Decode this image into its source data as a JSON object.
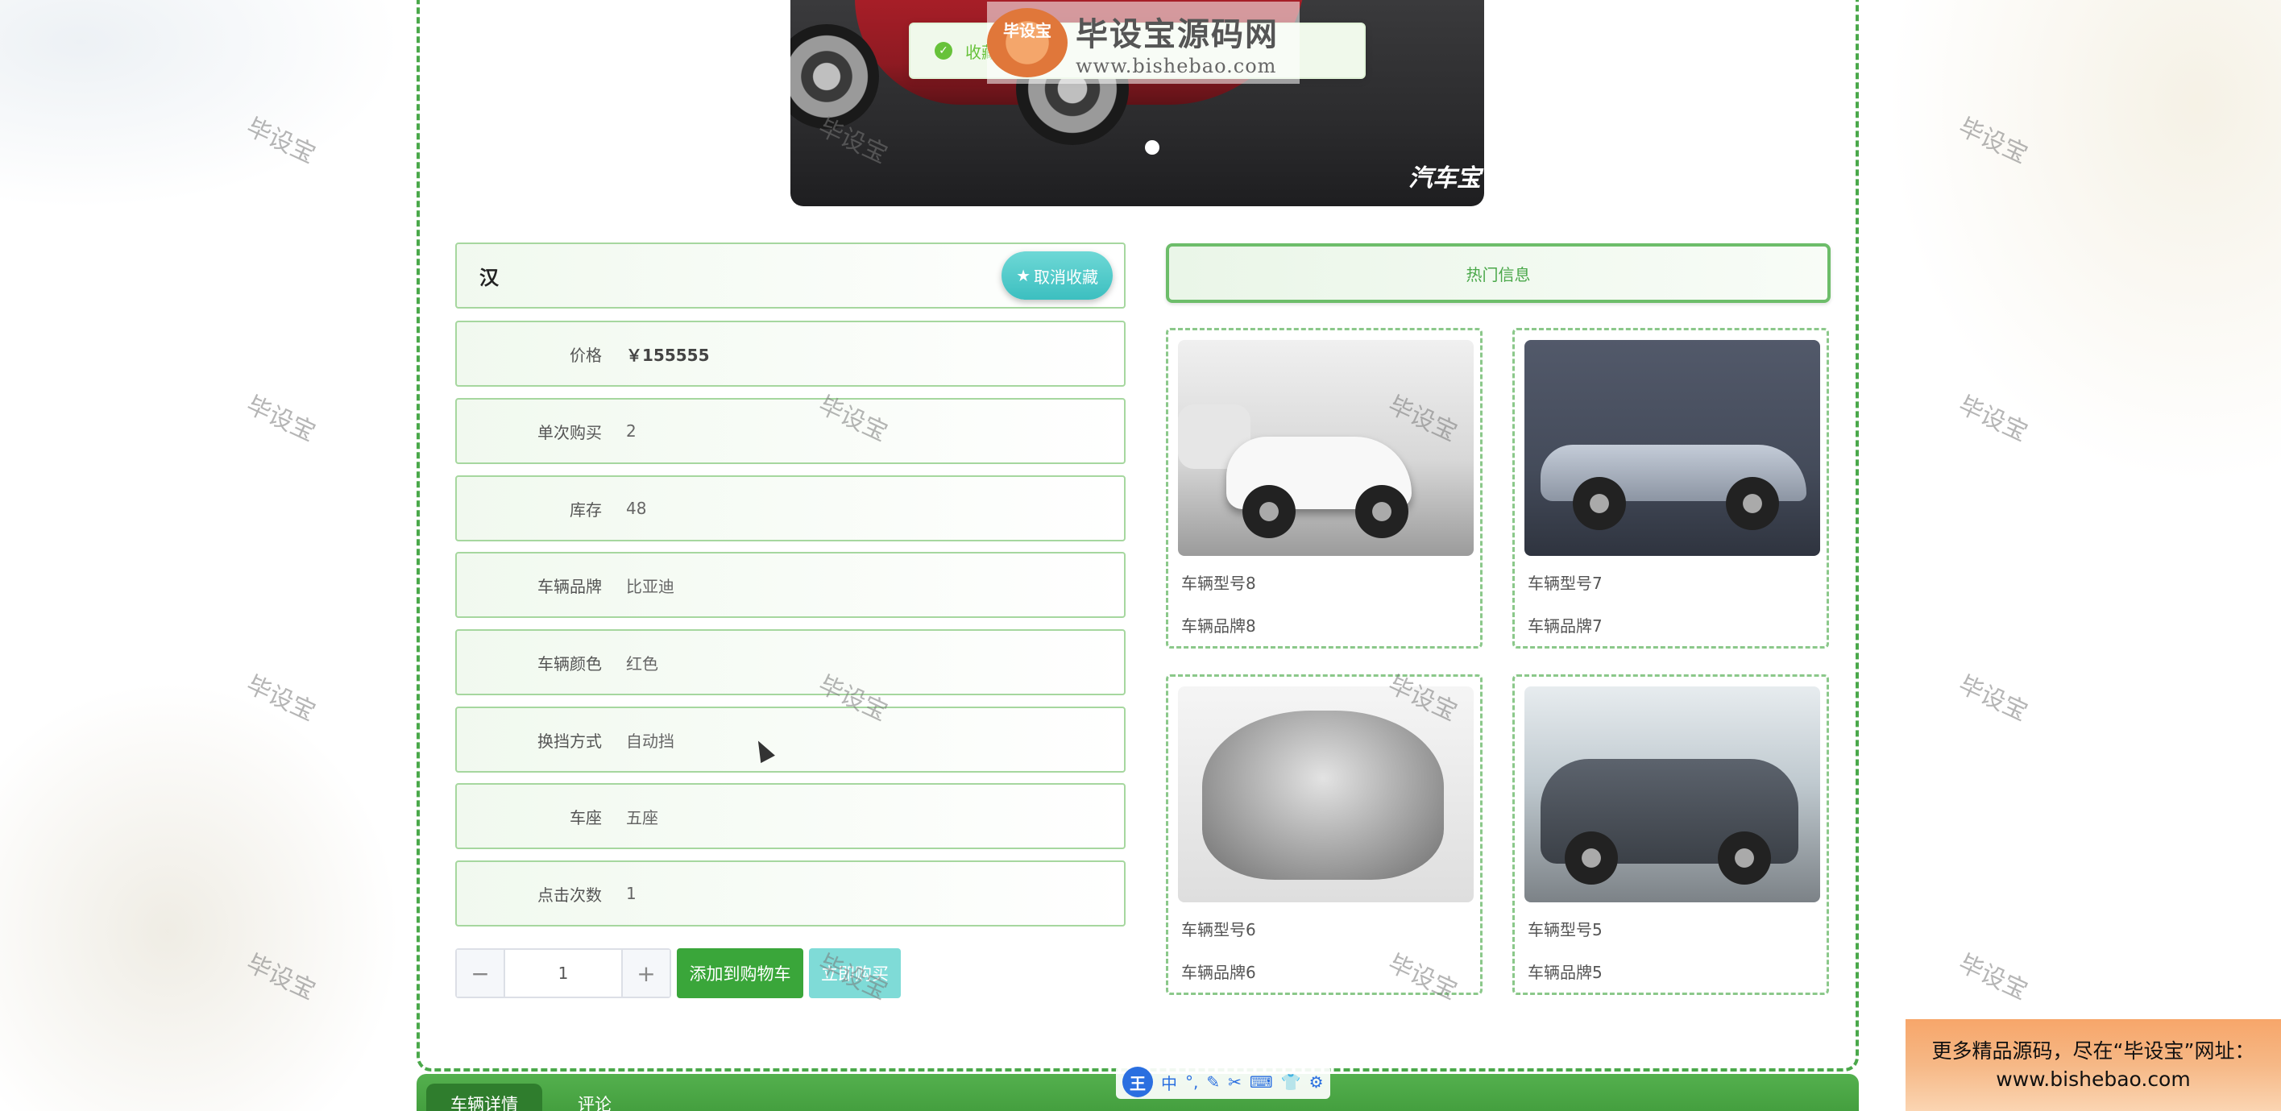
{
  "watermark_text": "毕设宝",
  "toast": {
    "message": "收藏成功"
  },
  "site_logo": {
    "badge": "毕设宝",
    "name": "毕设宝源码网",
    "url": "www.bishebao.com"
  },
  "banner": {
    "brand": "汽车宝"
  },
  "product": {
    "name": "汉",
    "favorite_button": "取消收藏",
    "fields": [
      {
        "label": "价格",
        "value": "￥155555"
      },
      {
        "label": "单次购买",
        "value": "2"
      },
      {
        "label": "库存",
        "value": "48"
      },
      {
        "label": "车辆品牌",
        "value": "比亚迪"
      },
      {
        "label": "车辆颜色",
        "value": "红色"
      },
      {
        "label": "换挡方式",
        "value": "自动挡"
      },
      {
        "label": "车座",
        "value": "五座"
      },
      {
        "label": "点击次数",
        "value": "1"
      }
    ]
  },
  "quantity": {
    "minus": "−",
    "value": "1",
    "plus": "+"
  },
  "actions": {
    "add_to_cart": "添加到购物车",
    "buy_now": "立即购买"
  },
  "hot": {
    "title": "热门信息",
    "items": [
      {
        "model": "车辆型号8",
        "brand": "车辆品牌8"
      },
      {
        "model": "车辆型号7",
        "brand": "车辆品牌7"
      },
      {
        "model": "车辆型号6",
        "brand": "车辆品牌6"
      },
      {
        "model": "车辆型号5",
        "brand": "车辆品牌5"
      }
    ]
  },
  "tabs": [
    {
      "label": "车辆详情"
    },
    {
      "label": "评论"
    }
  ],
  "ime": {
    "logo": "王",
    "mode": "中"
  },
  "ad": {
    "line1": "更多精品源码，尽在“毕设宝”网址：",
    "line2": "www.bishebao.com"
  }
}
